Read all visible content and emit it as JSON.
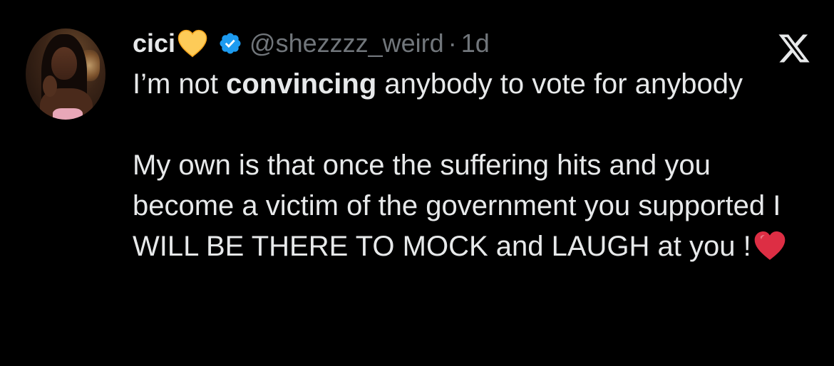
{
  "author": {
    "display_name": "cici",
    "name_emoji": "yellow-heart",
    "verified": true,
    "handle": "@shezzzz_weird",
    "separator": "·",
    "time": "1d"
  },
  "tweet": {
    "line1_before": "I’m not ",
    "line1_bold": "convincing",
    "line1_after": " anybody to vote for anybody",
    "para2": "My own is that once the suffering hits and you become a victim of the government you supported I WILL BE THERE TO MOCK and LAUGH at you !",
    "trailing_emoji": "red-heart"
  },
  "icons": {
    "brand": "x-logo",
    "verified": "verified-badge-icon"
  },
  "colors": {
    "background": "#000000",
    "text": "#e7e9ea",
    "secondary_text": "#71767b",
    "verified_blue": "#1d9bf0",
    "yellow_heart": "#fdcb58",
    "red_heart": "#dd2e44"
  }
}
